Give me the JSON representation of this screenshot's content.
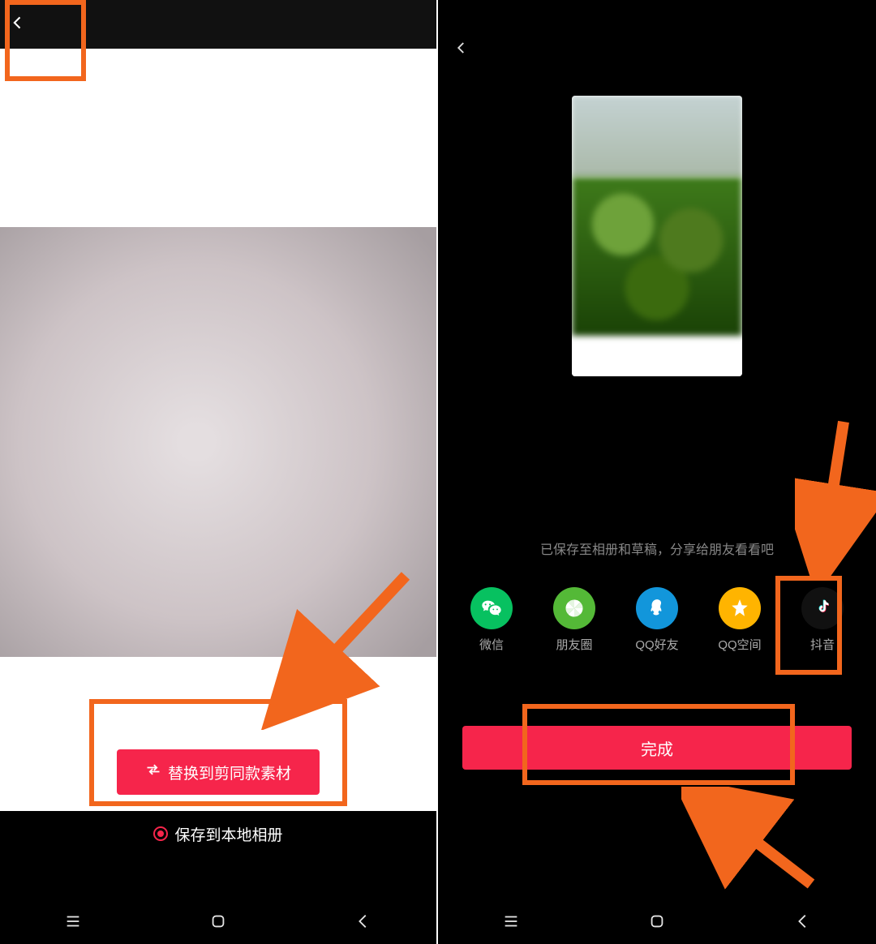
{
  "left": {
    "replace_button_label": "替换到剪同款素材",
    "save_label": "保存到本地相册"
  },
  "right": {
    "status_text": "已保存至相册和草稿，分享给朋友看看吧",
    "share_items": [
      {
        "id": "wechat",
        "label": "微信"
      },
      {
        "id": "moments",
        "label": "朋友圈"
      },
      {
        "id": "qq",
        "label": "QQ好友"
      },
      {
        "id": "qzone",
        "label": "QQ空间"
      },
      {
        "id": "douyin",
        "label": "抖音"
      }
    ],
    "done_button_label": "完成"
  }
}
